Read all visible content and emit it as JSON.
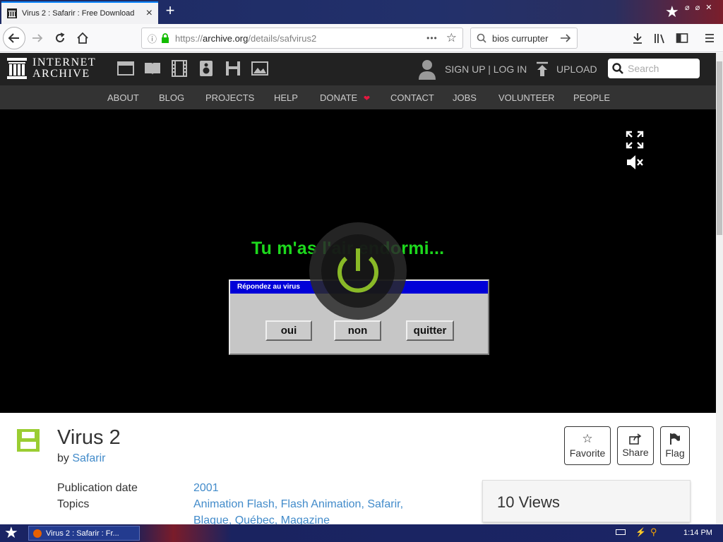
{
  "browser": {
    "tab_title": "Virus 2 : Safarir : Free Download, ",
    "tab_close": "×",
    "new_tab": "+",
    "url_scheme": "https://",
    "url_host": "archive.org",
    "url_path": "/details/safvirus2",
    "page_actions": "•••",
    "search_value": "bios currupter"
  },
  "ia_header": {
    "logo_line1": "INTERNET",
    "logo_line2": "ARCHIVE",
    "auth": "SIGN UP | LOG IN",
    "upload": "UPLOAD",
    "search_placeholder": "Search",
    "nav": [
      "ABOUT",
      "BLOG",
      "PROJECTS",
      "HELP",
      "DONATE",
      "CONTACT",
      "JOBS",
      "VOLUNTEER",
      "PEOPLE"
    ],
    "donate_heart_color": "#e5173f"
  },
  "emulator": {
    "flash_text": "Tu m'as l'air endormi...",
    "dialog_title": "Répondez au virus",
    "buttons": [
      "oui",
      "non",
      "quitter"
    ]
  },
  "item": {
    "title": "Virus 2",
    "by_label": "by ",
    "author": "Safarir",
    "actions": [
      "Favorite",
      "Share",
      "Flag"
    ],
    "pub_label": "Publication date",
    "pub_value": "2001",
    "topics_label": "Topics",
    "topics_line1": "Animation Flash, Flash Animation, Safarir,",
    "topics_line2": "Blague, Québec, Magazine",
    "views": "10 Views"
  },
  "taskbar": {
    "task_title": "Virus 2 : Safarir : Fr...",
    "clock": "1:14 PM"
  },
  "colors": {
    "accent_link": "#428bca",
    "flash_green": "#1dd81d",
    "dialog_titlebar": "#0000d8",
    "item_icon_green": "#9acd32"
  }
}
